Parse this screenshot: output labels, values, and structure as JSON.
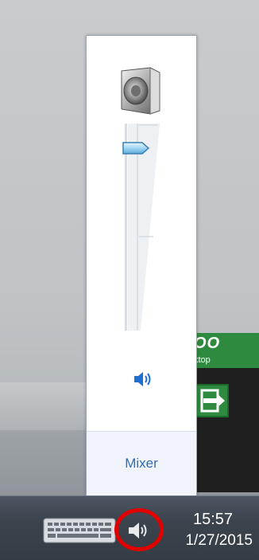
{
  "app_tile": {
    "title": "OO",
    "subtitle": "ktop",
    "icon": "exit-arrow-icon"
  },
  "flyout": {
    "device_icon": "speaker-device-icon",
    "volume_level_percent": 88,
    "mute_icon": "speaker-volume-icon",
    "mixer_label": "Mixer"
  },
  "taskbar": {
    "keyboard_icon": "keyboard-icon",
    "tray_volume_icon": "speaker-volume-icon",
    "time": "15:57",
    "date": "1/27/2015"
  },
  "colors": {
    "highlight_ring": "#e00000",
    "tile_green": "#2d8a3e",
    "mixer_link": "#2e6db6",
    "taskbar": "#3b434d"
  }
}
